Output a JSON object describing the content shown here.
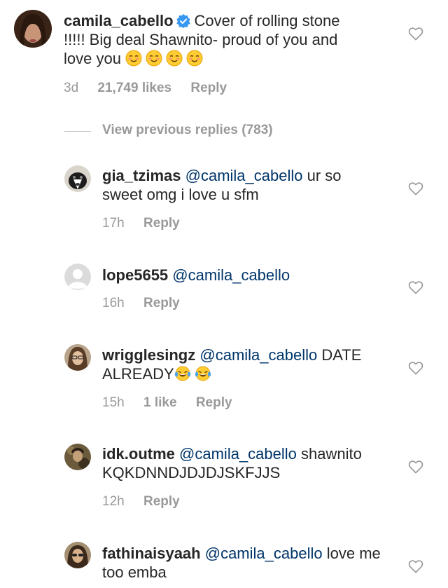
{
  "main_comment": {
    "username": "camila_cabello",
    "verified_icon": "verified-badge-icon",
    "text": "Cover of rolling stone !!!!! Big deal Shawnito- proud of you and love you",
    "emoji": "smiling-face-emoji",
    "emoji_count": 4,
    "time": "3d",
    "likes": "21,749 likes",
    "reply_label": "Reply"
  },
  "view_previous_replies": "View previous replies (783)",
  "replies": [
    {
      "username": "gia_tzimas",
      "mention": "@camila_cabello",
      "text": "ur so sweet omg i love u sfm",
      "time": "17h",
      "likes": "",
      "reply_label": "Reply"
    },
    {
      "username": "lope5655",
      "mention": "@camila_cabello",
      "text": "",
      "time": "16h",
      "likes": "",
      "reply_label": "Reply"
    },
    {
      "username": "wrigglesingz",
      "mention": "@camila_cabello",
      "text": "DATE ALREADY",
      "emoji": "tears-of-joy-emoji",
      "emoji_count": 2,
      "time": "15h",
      "likes": "1 like",
      "reply_label": "Reply"
    },
    {
      "username": "idk.outme",
      "mention": "@camila_cabello",
      "text": "shawnito KQKDNNDJDJDJSKFJJS",
      "time": "12h",
      "likes": "",
      "reply_label": "Reply"
    },
    {
      "username": "fathinaisyaah",
      "mention": "@camila_cabello",
      "text": "love me too emba",
      "time": "",
      "likes": "",
      "reply_label": ""
    }
  ],
  "colors": {
    "text": "#262626",
    "mention": "#003569",
    "meta": "#999999",
    "verified": "#3897f0",
    "heart_outline": "#999999"
  }
}
